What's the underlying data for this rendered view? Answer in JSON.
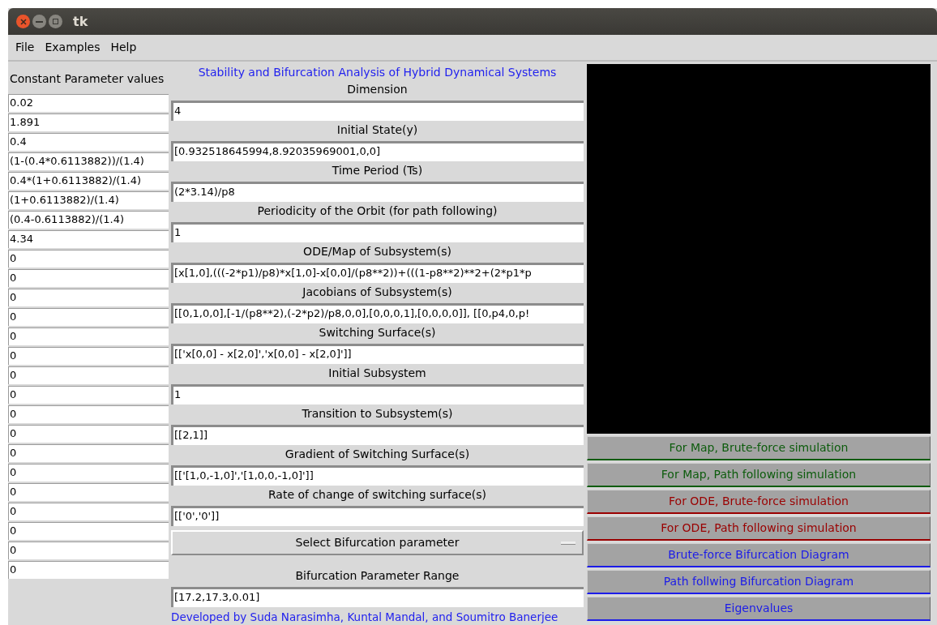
{
  "window": {
    "title": "tk"
  },
  "menu": [
    "File",
    "Examples",
    "Help"
  ],
  "parameters": {
    "heading": "Constant Parameter values",
    "values": [
      "0.02",
      "1.891",
      "0.4",
      "(1-(0.4*0.6113882))/(1.4)",
      "0.4*(1+0.6113882)/(1.4)",
      "(1+0.6113882)/(1.4)",
      "(0.4-0.6113882)/(1.4)",
      "4.34",
      "0",
      "0",
      "0",
      "0",
      "0",
      "0",
      "0",
      "0",
      "0",
      "0",
      "0",
      "0",
      "0",
      "0",
      "0",
      "0",
      "0"
    ]
  },
  "form": {
    "title": "Stability and Bifurcation Analysis of Hybrid Dynamical Systems",
    "fields": [
      {
        "label": "Dimension",
        "value": "4"
      },
      {
        "label": "Initial State(y)",
        "value": "[0.932518645994,8.92035969001,0,0]"
      },
      {
        "label": "Time Period (Ts)",
        "value": "(2*3.14)/p8"
      },
      {
        "label": "Periodicity of the Orbit (for path following)",
        "value": "1"
      },
      {
        "label": "ODE/Map of Subsystem(s)",
        "value": "[x[1,0],(((-2*p1)/p8)*x[1,0]-x[0,0]/(p8**2))+(((1-p8**2)**2+(2*p1*p"
      },
      {
        "label": "Jacobians of Subsystem(s)",
        "value": "[[0,1,0,0],[-1/(p8**2),(-2*p2)/p8,0,0],[0,0,0,1],[0,0,0,0]], [[0,p4,0,p!"
      },
      {
        "label": "Switching Surface(s)",
        "value": "[['x[0,0] - x[2,0]','x[0,0] - x[2,0]']]"
      },
      {
        "label": "Initial Subsystem",
        "value": "1"
      },
      {
        "label": "Transition to Subsystem(s)",
        "value": "[[2,1]]"
      },
      {
        "label": "Gradient of Switching Surface(s)",
        "value": "[['[1,0,-1,0]','[1,0,0,-1,0]']]"
      },
      {
        "label": "Rate of change of switching surface(s)",
        "value": "[['0','0']]"
      }
    ],
    "dropdown": "Select Bifurcation parameter",
    "range": {
      "label": "Bifurcation Parameter Range",
      "value": "[17.2,17.3,0.01]"
    },
    "credits": "Developed by Suda Narasimha, Kuntal Mandal, and Soumitro Banerjee"
  },
  "actions": [
    {
      "label": "For Map, Brute-force simulation",
      "color": "#0d5c0d"
    },
    {
      "label": "For Map, Path following simulation",
      "color": "#0d5c0d"
    },
    {
      "label": "For ODE, Brute-force simulation",
      "color": "#9a0000"
    },
    {
      "label": "For ODE, Path following simulation",
      "color": "#9a0000"
    },
    {
      "label": "Brute-force Bifurcation Diagram",
      "color": "#1c1ce8"
    },
    {
      "label": "Path follwing Bifurcation Diagram",
      "color": "#1c1ce8"
    },
    {
      "label": "Eigenvalues",
      "color": "#1c1ce8"
    }
  ]
}
